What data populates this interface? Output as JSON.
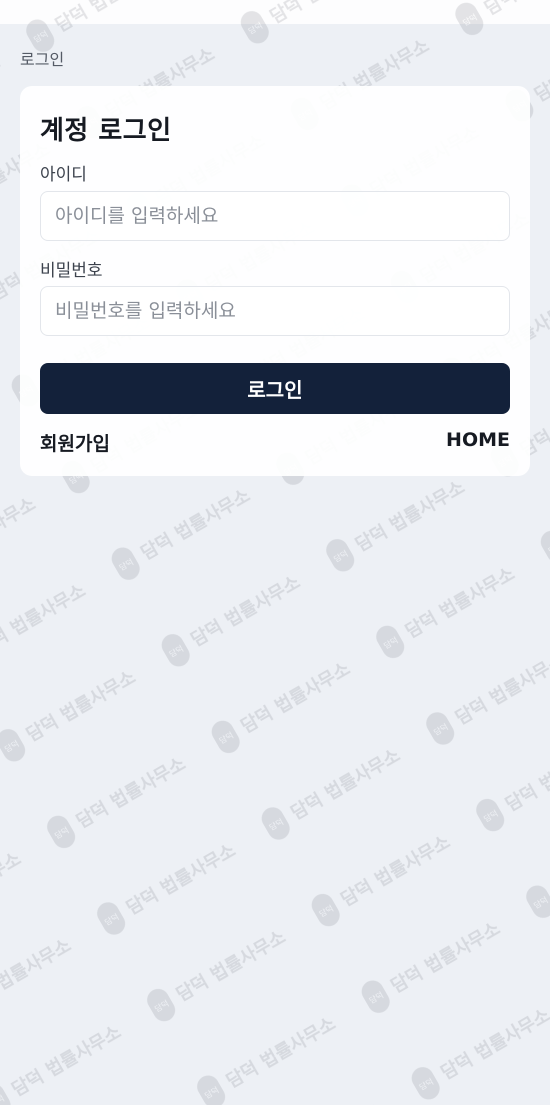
{
  "page": {
    "heading": "로그인"
  },
  "watermark": {
    "text": "담덕 법률사무소",
    "seal_text": "담덕"
  },
  "login_card": {
    "title": "계정 로그인",
    "username": {
      "label": "아이디",
      "placeholder": "아이디를 입력하세요",
      "value": ""
    },
    "password": {
      "label": "비밀번호",
      "placeholder": "비밀번호를 입력하세요",
      "value": ""
    },
    "submit_label": "로그인",
    "signup_link": "회원가입",
    "home_link": "HOME"
  },
  "colors": {
    "background": "#edf0f5",
    "button": "#13213a",
    "card": "#ffffff"
  }
}
